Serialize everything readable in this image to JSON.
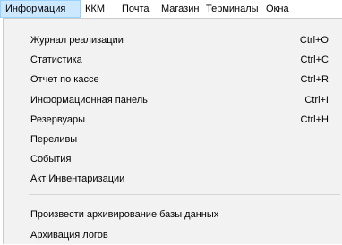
{
  "menubar": {
    "items": [
      {
        "label": "Информация",
        "active": true
      },
      {
        "label": "ККМ",
        "active": false
      },
      {
        "label": "Почта",
        "active": false
      },
      {
        "label": "Магазин",
        "active": false
      },
      {
        "label": "Терминалы",
        "active": false
      },
      {
        "label": "Окна",
        "active": false
      }
    ]
  },
  "dropdown": {
    "items": [
      {
        "label": "Журнал реализации",
        "shortcut": "Ctrl+O"
      },
      {
        "label": "Статистика",
        "shortcut": "Ctrl+C"
      },
      {
        "label": "Отчет по кассе",
        "shortcut": "Ctrl+R"
      },
      {
        "label": "Информационная панель",
        "shortcut": "Ctrl+I"
      },
      {
        "label": "Резервуары",
        "shortcut": "Ctrl+H"
      },
      {
        "label": "Переливы",
        "shortcut": ""
      },
      {
        "label": "События",
        "shortcut": ""
      },
      {
        "label": "Акт Инвентаризации",
        "shortcut": ""
      },
      {
        "label": "Произвести архивирование базы данных",
        "shortcut": ""
      },
      {
        "label": "Архивация логов",
        "shortcut": ""
      }
    ]
  },
  "colors": {
    "menubar_active_bg": "#cce8ff",
    "menubar_active_border": "#99d1ff",
    "dropdown_bg": "#f2f2f2",
    "separator": "#d7d7d7"
  }
}
